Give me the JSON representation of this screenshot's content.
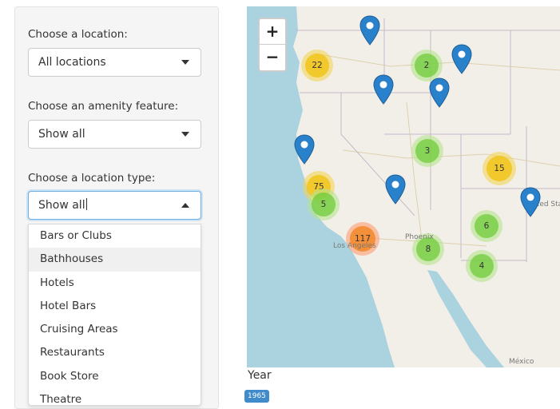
{
  "filters": {
    "location": {
      "label": "Choose a location:",
      "value": "All locations"
    },
    "amenity": {
      "label": "Choose an amenity feature:",
      "value": "Show all"
    },
    "location_type": {
      "label": "Choose a location type:",
      "value": "Show all",
      "options": [
        "Bars or Clubs",
        "Bathhouses",
        "Hotels",
        "Hotel Bars",
        "Cruising Areas",
        "Restaurants",
        "Book Store",
        "Theatre"
      ]
    }
  },
  "map": {
    "zoom_in": "+",
    "zoom_out": "−",
    "clusters": [
      "22",
      "2",
      "3",
      "15",
      "75",
      "5",
      "6",
      "117",
      "8",
      "4"
    ],
    "labels": {
      "los_angeles": "Los Angeles",
      "phoenix": "Phoenix",
      "united_states": "United States",
      "mexico": "México"
    },
    "colors": {
      "water": "#aad3df",
      "land": "#f2efe9",
      "marker": "#2a81cb"
    }
  },
  "year": {
    "label": "Year",
    "value": "1965"
  }
}
